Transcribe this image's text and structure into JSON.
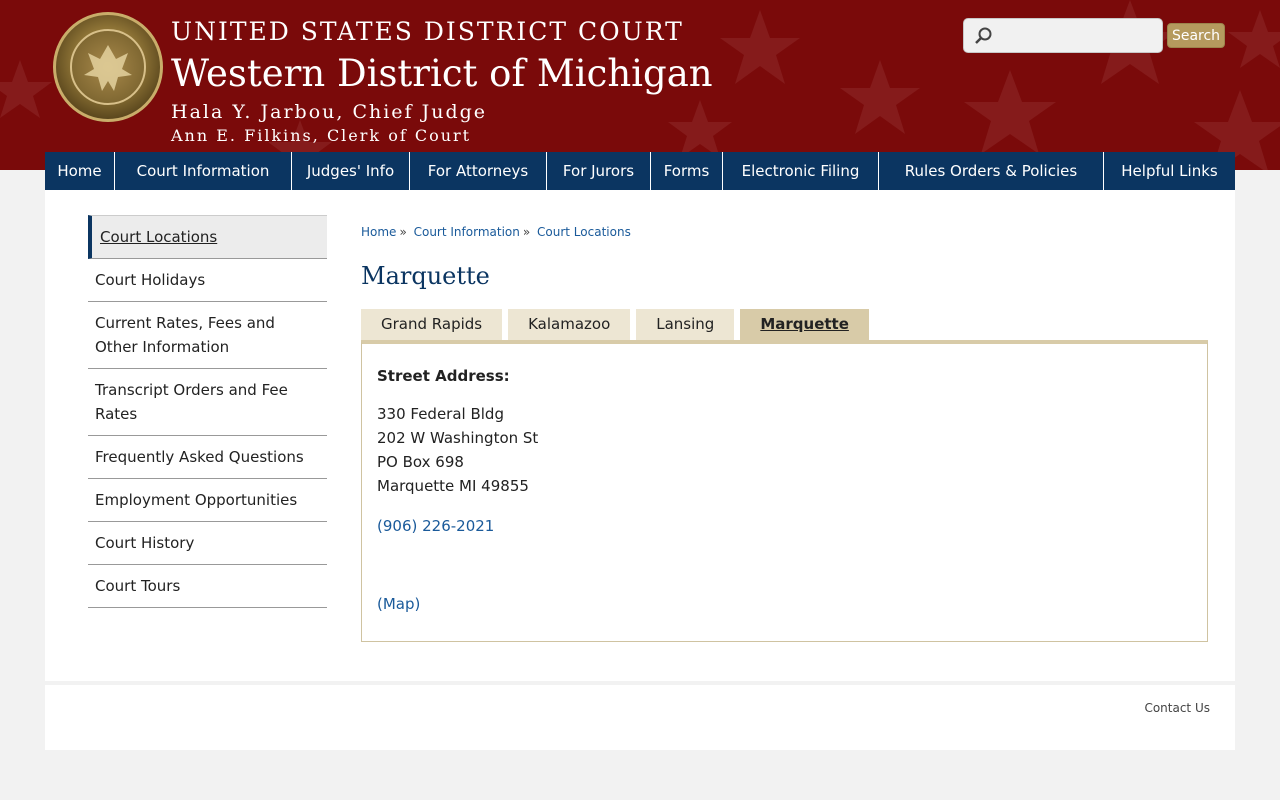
{
  "header": {
    "title_top": "UNITED STATES DISTRICT COURT",
    "title_main": "Western District of Michigan",
    "chief_judge": "Hala Y. Jarbou, Chief Judge",
    "clerk": "Ann E. Filkins, Clerk of Court",
    "seal_icon": "court-seal",
    "search_icon": "magnifier-icon",
    "search_placeholder": "",
    "search_button": "Search",
    "colors": {
      "banner": "#7a0a0a",
      "nav": "#0b3561",
      "search_button": "#b59a5e"
    }
  },
  "nav": {
    "items": [
      {
        "label": "Home"
      },
      {
        "label": "Court Information"
      },
      {
        "label": "Judges' Info"
      },
      {
        "label": "For Attorneys"
      },
      {
        "label": "For Jurors"
      },
      {
        "label": "Forms"
      },
      {
        "label": "Electronic Filing"
      },
      {
        "label": "Rules Orders & Policies"
      },
      {
        "label": "Helpful Links"
      }
    ]
  },
  "sidebar": {
    "items": [
      {
        "label": "Court Locations"
      },
      {
        "label": "Court Holidays"
      },
      {
        "label": "Current Rates, Fees and Other Information"
      },
      {
        "label": "Transcript Orders and Fee Rates"
      },
      {
        "label": "Frequently Asked Questions"
      },
      {
        "label": "Employment Opportunities"
      },
      {
        "label": "Court History"
      },
      {
        "label": "Court Tours"
      }
    ]
  },
  "breadcrumb": {
    "items": [
      "Home",
      "Court Information",
      "Court Locations"
    ],
    "separator": "»"
  },
  "page": {
    "title": "Marquette",
    "tabs": [
      {
        "label": "Grand Rapids"
      },
      {
        "label": "Kalamazoo"
      },
      {
        "label": "Lansing"
      },
      {
        "label": "Marquette"
      }
    ],
    "street_label": "Street Address:",
    "address": [
      "330 Federal Bldg",
      "202 W Washington St",
      "PO Box 698",
      "Marquette MI 49855"
    ],
    "phone": "(906) 226-2021",
    "map_link": "(Map)"
  },
  "footer": {
    "contact": "Contact Us"
  }
}
